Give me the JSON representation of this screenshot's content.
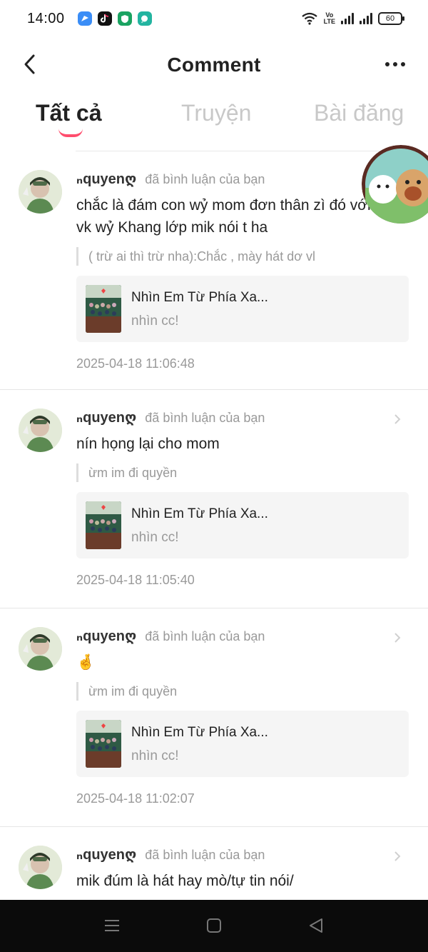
{
  "status_bar": {
    "time": "14:00",
    "battery": "60",
    "network_label_top": "Vo",
    "network_label_bottom": "LTE"
  },
  "header": {
    "title": "Comment"
  },
  "tabs": [
    {
      "label": "Tất cả",
      "active": true
    },
    {
      "label": "Truyện",
      "active": false
    },
    {
      "label": "Bài đăng",
      "active": false
    }
  ],
  "colors": {
    "accent": "#ff4d6d",
    "muted": "#999999",
    "card_bg": "#f5f5f5"
  },
  "comments": [
    {
      "username": "ₙquyenღ",
      "action": "đã bình luận của bạn",
      "text": "chắc là đám con wỷ mom đơn thân zì đó với vk wỷ Khang lớp mik nói t ha",
      "quote": "( trừ  ai thì trừ nha):Chắc , mày hát dơ vl",
      "card_title": "Nhìn Em Từ Phía Xa...",
      "card_sub": "nhìn cc!",
      "timestamp": "2025-04-18 11:06:48"
    },
    {
      "username": "ₙquyenღ",
      "action": "đã bình luận của bạn",
      "text": "nín họng lại cho mom",
      "quote": "ừm im đi quyền",
      "card_title": "Nhìn Em Từ Phía Xa...",
      "card_sub": "nhìn cc!",
      "timestamp": "2025-04-18 11:05:40"
    },
    {
      "username": "ₙquyenღ",
      "action": "đã bình luận của bạn",
      "text": "🤞",
      "quote": "ừm im đi quyền",
      "card_title": "Nhìn Em Từ Phía Xa...",
      "card_sub": "nhìn cc!",
      "timestamp": "2025-04-18 11:02:07"
    },
    {
      "username": "ₙquyenღ",
      "action": "đã bình luận của bạn",
      "text": "mik đúm là hát hay mò/tự tin nói/",
      "quote": "",
      "card_title": "",
      "card_sub": "",
      "timestamp": ""
    }
  ],
  "icons": {
    "back": "chevron-left-icon",
    "more": "more-dots-icon",
    "nav_menu": "menu-icon",
    "nav_home": "home-square-icon",
    "nav_back": "back-triangle-icon"
  }
}
